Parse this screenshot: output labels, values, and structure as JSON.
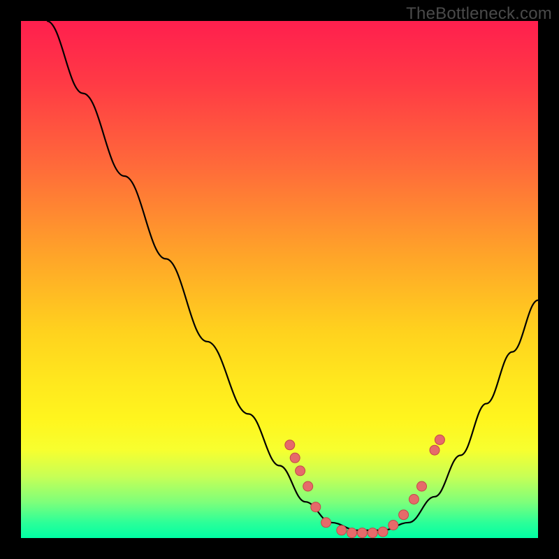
{
  "watermark": "TheBottleneck.com",
  "chart_data": {
    "type": "line",
    "title": "",
    "xlabel": "",
    "ylabel": "",
    "xlim": [
      0,
      100
    ],
    "ylim": [
      0,
      100
    ],
    "background_gradient": [
      "#ff1f4e",
      "#ffd21e",
      "#00ffa4"
    ],
    "curve": {
      "name": "bottleneck-curve",
      "points": [
        {
          "x": 5,
          "y": 100
        },
        {
          "x": 12,
          "y": 86
        },
        {
          "x": 20,
          "y": 70
        },
        {
          "x": 28,
          "y": 54
        },
        {
          "x": 36,
          "y": 38
        },
        {
          "x": 44,
          "y": 24
        },
        {
          "x": 50,
          "y": 14
        },
        {
          "x": 55,
          "y": 7
        },
        {
          "x": 60,
          "y": 3
        },
        {
          "x": 65,
          "y": 1.5
        },
        {
          "x": 70,
          "y": 1.5
        },
        {
          "x": 75,
          "y": 3
        },
        {
          "x": 80,
          "y": 8
        },
        {
          "x": 85,
          "y": 16
        },
        {
          "x": 90,
          "y": 26
        },
        {
          "x": 95,
          "y": 36
        },
        {
          "x": 100,
          "y": 46
        }
      ]
    },
    "series": [
      {
        "name": "marker-points",
        "type": "scatter",
        "points": [
          {
            "x": 52,
            "y": 18
          },
          {
            "x": 53,
            "y": 15.5
          },
          {
            "x": 54,
            "y": 13
          },
          {
            "x": 55.5,
            "y": 10
          },
          {
            "x": 57,
            "y": 6
          },
          {
            "x": 59,
            "y": 3
          },
          {
            "x": 62,
            "y": 1.5
          },
          {
            "x": 64,
            "y": 1
          },
          {
            "x": 66,
            "y": 1
          },
          {
            "x": 68,
            "y": 1
          },
          {
            "x": 70,
            "y": 1.2
          },
          {
            "x": 72,
            "y": 2.5
          },
          {
            "x": 74,
            "y": 4.5
          },
          {
            "x": 76,
            "y": 7.5
          },
          {
            "x": 77.5,
            "y": 10
          },
          {
            "x": 80,
            "y": 17
          },
          {
            "x": 81,
            "y": 19
          }
        ]
      }
    ]
  }
}
